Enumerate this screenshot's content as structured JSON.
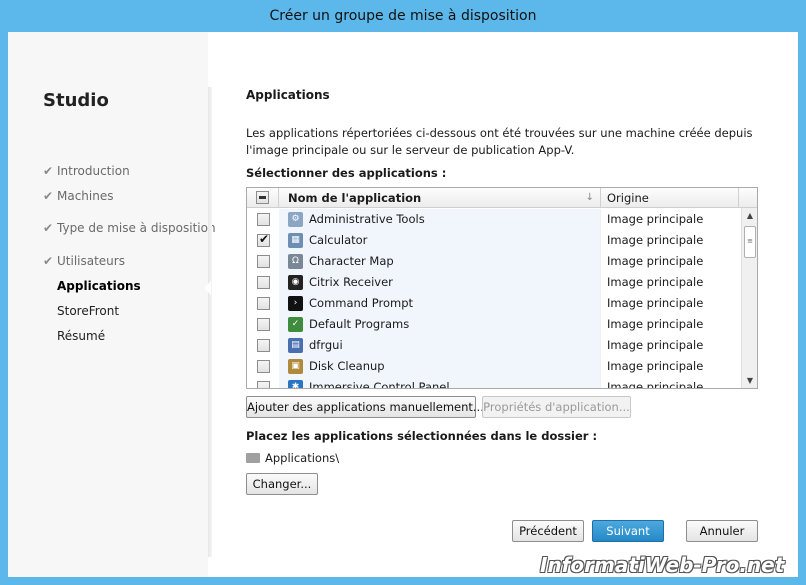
{
  "window": {
    "title": "Créer un groupe de mise à disposition"
  },
  "sidebar": {
    "title": "Studio",
    "steps": [
      {
        "label": "Introduction",
        "state": "done"
      },
      {
        "label": "Machines",
        "state": "done"
      },
      {
        "label": "Type de mise à disposition",
        "state": "done"
      },
      {
        "label": "Utilisateurs",
        "state": "done"
      },
      {
        "label": "Applications",
        "state": "current"
      },
      {
        "label": "StoreFront",
        "state": "future"
      },
      {
        "label": "Résumé",
        "state": "future"
      }
    ]
  },
  "main": {
    "title": "Applications",
    "description": "Les applications répertoriées ci-dessous ont été trouvées sur une machine créée depuis l'image principale ou sur le serveur de publication App-V.",
    "select_label": "Sélectionner des applications :",
    "table": {
      "columns": [
        "Nom de l'application",
        "Origine"
      ],
      "sort_glyph": "↓",
      "rows": [
        {
          "name": "Administrative Tools",
          "origin": "Image principale",
          "checked": false,
          "icon": "administrative-tools-icon",
          "color": "#8aa6c4"
        },
        {
          "name": "Calculator",
          "origin": "Image principale",
          "checked": true,
          "icon": "calculator-icon",
          "color": "#6d8fb4"
        },
        {
          "name": "Character Map",
          "origin": "Image principale",
          "checked": false,
          "icon": "character-map-icon",
          "color": "#7a8796"
        },
        {
          "name": "Citrix Receiver",
          "origin": "Image principale",
          "checked": false,
          "icon": "citrix-receiver-icon",
          "color": "#222222"
        },
        {
          "name": "Command Prompt",
          "origin": "Image principale",
          "checked": false,
          "icon": "command-prompt-icon",
          "color": "#111111"
        },
        {
          "name": "Default Programs",
          "origin": "Image principale",
          "checked": false,
          "icon": "default-programs-icon",
          "color": "#3f8c3f"
        },
        {
          "name": "dfrgui",
          "origin": "Image principale",
          "checked": false,
          "icon": "dfrgui-icon",
          "color": "#4a6fb0"
        },
        {
          "name": "Disk Cleanup",
          "origin": "Image principale",
          "checked": false,
          "icon": "disk-cleanup-icon",
          "color": "#b08a3c"
        },
        {
          "name": "Immersive Control Panel",
          "origin": "Image principale",
          "checked": false,
          "icon": "control-panel-icon",
          "color": "#2a74c4"
        }
      ]
    },
    "buttons": {
      "add_manual": "Ajouter des applications manuellement...",
      "properties": "Propriétés d'application...",
      "change": "Changer..."
    },
    "folder_label": "Placez les applications sélectionnées dans le dossier :",
    "folder_path": "Applications\\"
  },
  "footer": {
    "back": "Précédent",
    "next": "Suivant",
    "cancel": "Annuler"
  },
  "watermark": "InformatiWeb-Pro.net"
}
